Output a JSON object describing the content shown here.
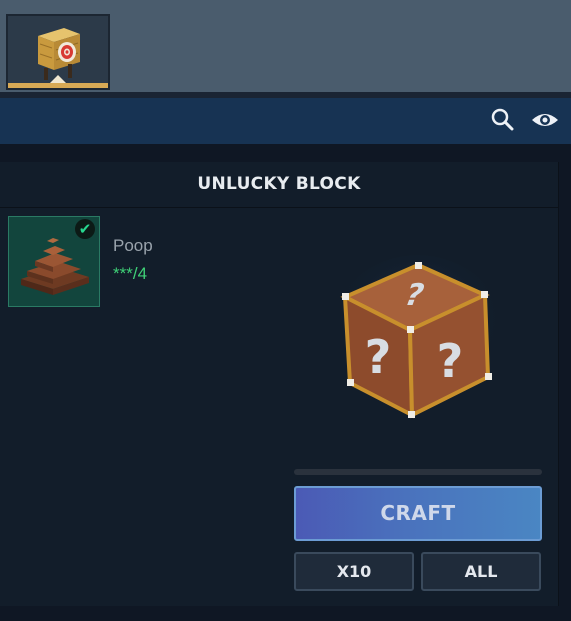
{
  "tab": {
    "icon": "target-icon"
  },
  "toolbar": {
    "search_icon": "search-icon",
    "view_icon": "eye-icon"
  },
  "recipe": {
    "title": "UNLUCKY BLOCK",
    "ingredient": {
      "name": "Poop",
      "count": "***/4",
      "icon": "poop-icon",
      "status_icon": "check-icon"
    },
    "result_icon": "unlucky-block-icon",
    "progress": 0
  },
  "buttons": {
    "craft": "CRAFT",
    "x10": "X10",
    "all": "ALL"
  },
  "colors": {
    "accent": "#4a72bd",
    "check": "#27d78f",
    "count": "#3fd077",
    "tab_underline": "#d7a955"
  }
}
